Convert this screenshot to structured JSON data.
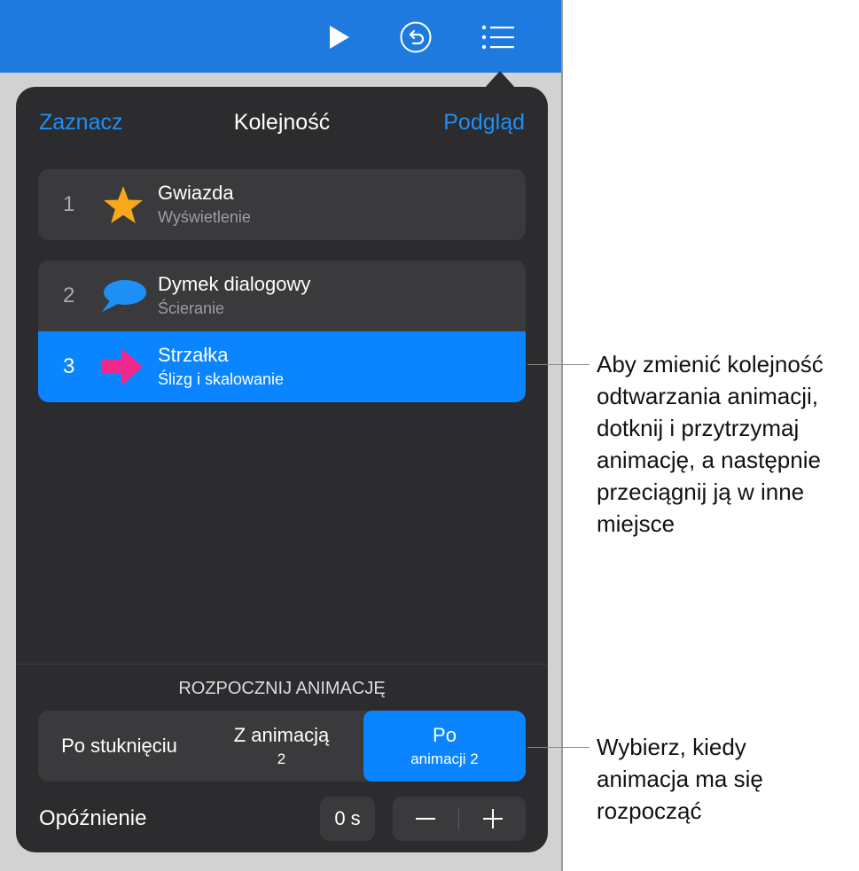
{
  "toolbar": {
    "icons": [
      "play-icon",
      "undo-icon",
      "list-icon"
    ]
  },
  "popover": {
    "select_label": "Zaznacz",
    "title": "Kolejność",
    "preview_label": "Podgląd",
    "animations": [
      {
        "number": "1",
        "name": "Gwiazda",
        "effect": "Wyświetlenie",
        "icon": "star-icon",
        "selected": false
      },
      {
        "number": "2",
        "name": "Dymek dialogowy",
        "effect": "Ścieranie",
        "icon": "speech-bubble-icon",
        "selected": false
      },
      {
        "number": "3",
        "name": "Strzałka",
        "effect": "Ślizg i skalowanie",
        "icon": "arrow-icon",
        "selected": true
      }
    ],
    "start_section_label": "ROZPOCZNIJ ANIMACJĘ",
    "start_options": [
      {
        "label": "Po stuknięciu",
        "sub": ""
      },
      {
        "label": "Z animacją",
        "sub": "2"
      },
      {
        "label": "Po",
        "sub": "animacji 2"
      }
    ],
    "selected_start_option": 2,
    "delay_label": "Opóźnienie",
    "delay_value": "0 s",
    "stepper": {
      "minus": "−",
      "plus": "+"
    }
  },
  "callouts": [
    {
      "text": "Aby zmienić kolejność\nodtwarzania animacji,\ndotknij i przytrzymaj\nanimację, a następnie\nprzeciągnij ją w inne\nmiejsce"
    },
    {
      "text": "Wybierz, kiedy\nanimacja ma się\nrozpocząć"
    }
  ],
  "colors": {
    "accent": "#0a84ff",
    "toolbar": "#1f7ae0",
    "popover_bg": "#2c2c2e",
    "star": "#f7a81b",
    "bubble": "#1e8ff5",
    "arrow": "#f0288c"
  }
}
